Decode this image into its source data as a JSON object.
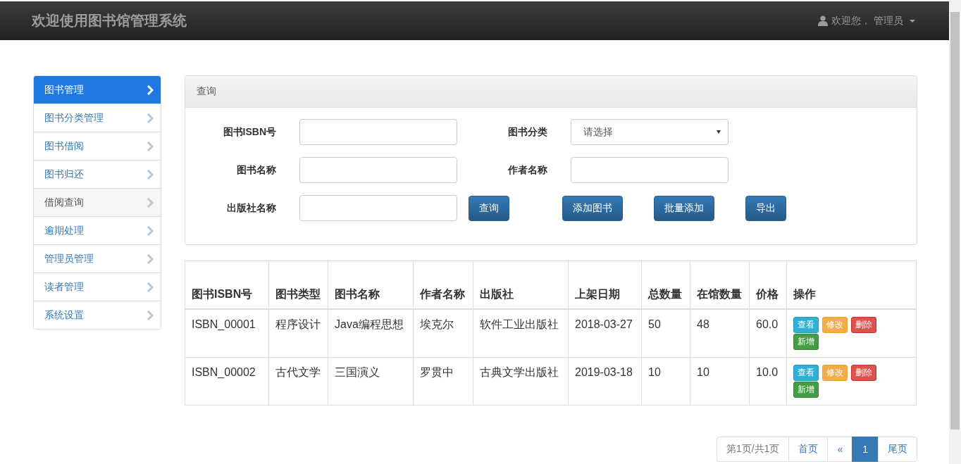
{
  "navbar": {
    "brand": "欢迎使用图书馆管理系统",
    "user": "欢迎您， 管理员"
  },
  "sidebar": {
    "items": [
      {
        "label": "图书管理",
        "selected": true,
        "highlighted": false
      },
      {
        "label": "图书分类管理",
        "selected": false,
        "highlighted": false
      },
      {
        "label": "图书借阅",
        "selected": false,
        "highlighted": false
      },
      {
        "label": "图书归还",
        "selected": false,
        "highlighted": false
      },
      {
        "label": "借阅查询",
        "selected": false,
        "highlighted": true
      },
      {
        "label": "逾期处理",
        "selected": false,
        "highlighted": false
      },
      {
        "label": "管理员管理",
        "selected": false,
        "highlighted": false
      },
      {
        "label": "读者管理",
        "selected": false,
        "highlighted": false
      },
      {
        "label": "系统设置",
        "selected": false,
        "highlighted": false
      }
    ]
  },
  "query_panel": {
    "title": "查询",
    "rows": [
      [
        {
          "label": "图书ISBN号",
          "kind": "input"
        },
        {
          "label": "图书分类",
          "kind": "select",
          "placeholder": "请选择"
        }
      ],
      [
        {
          "label": "图书名称",
          "kind": "input"
        },
        {
          "label": "作者名称",
          "kind": "input"
        }
      ],
      [
        {
          "label": "出版社名称",
          "kind": "input"
        }
      ]
    ],
    "buttons": [
      "查询",
      "添加图书",
      "批量添加",
      "导出"
    ]
  },
  "table": {
    "columns": [
      "图书ISBN号",
      "图书类型",
      "图书名称",
      "作者名称",
      "出版社",
      "上架日期",
      "总数量",
      "在馆数量",
      "价格",
      "操作"
    ],
    "rows": [
      {
        "cells": [
          "ISBN_00001",
          "程序设计",
          "Java编程思想",
          "埃克尔",
          "软件工业出版社",
          "2018-03-27",
          "50",
          "48",
          "60.0"
        ],
        "actions": [
          {
            "label": "查看",
            "kind": "view"
          },
          {
            "label": "修改",
            "kind": "edit"
          },
          {
            "label": "删除",
            "kind": "delete"
          },
          {
            "label": "新增",
            "kind": "add"
          }
        ]
      },
      {
        "cells": [
          "ISBN_00002",
          "古代文学",
          "三国演义",
          "罗贯中",
          "古典文学出版社",
          "2019-03-18",
          "10",
          "10",
          "10.0"
        ],
        "actions": [
          {
            "label": "查看",
            "kind": "view"
          },
          {
            "label": "修改",
            "kind": "edit"
          },
          {
            "label": "删除",
            "kind": "delete"
          },
          {
            "label": "新增",
            "kind": "add"
          }
        ]
      }
    ]
  },
  "pagination": {
    "info": "第1页/共1页",
    "items": [
      {
        "label": "首页",
        "selected": false
      },
      {
        "label": "«",
        "selected": false
      },
      {
        "label": "1",
        "selected": true
      },
      {
        "label": "尾页",
        "selected": false
      }
    ]
  }
}
